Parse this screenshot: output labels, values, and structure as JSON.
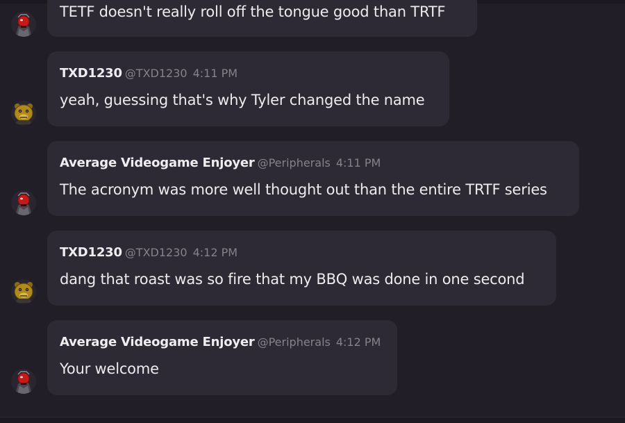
{
  "messages": [
    {
      "author": "",
      "handle": "",
      "time": "",
      "text": "TETF doesn't really roll off the tongue good than TRTF",
      "avatar": "red-mask-avatar"
    },
    {
      "author": "TXD1230",
      "handle": "@TXD1230",
      "time": "4:11 PM",
      "text": "yeah, guessing that's why Tyler changed the name",
      "avatar": "gold-bear-avatar"
    },
    {
      "author": "Average Videogame Enjoyer",
      "handle": "@Peripherals",
      "time": "4:11 PM",
      "text": "The acronym was more well thought out than the entire TRTF series",
      "avatar": "red-mask-avatar"
    },
    {
      "author": "TXD1230",
      "handle": "@TXD1230",
      "time": "4:12 PM",
      "text": "dang that roast was so fire that my BBQ was done in one second",
      "avatar": "gold-bear-avatar"
    },
    {
      "author": "Average Videogame Enjoyer",
      "handle": "@Peripherals",
      "time": "4:12 PM",
      "text": "Your welcome",
      "avatar": "red-mask-avatar"
    }
  ],
  "colors": {
    "background": "#221e27",
    "bubble": "#2e2a35",
    "author": "#eeeef0",
    "muted": "#85828b",
    "text": "#ececee"
  }
}
